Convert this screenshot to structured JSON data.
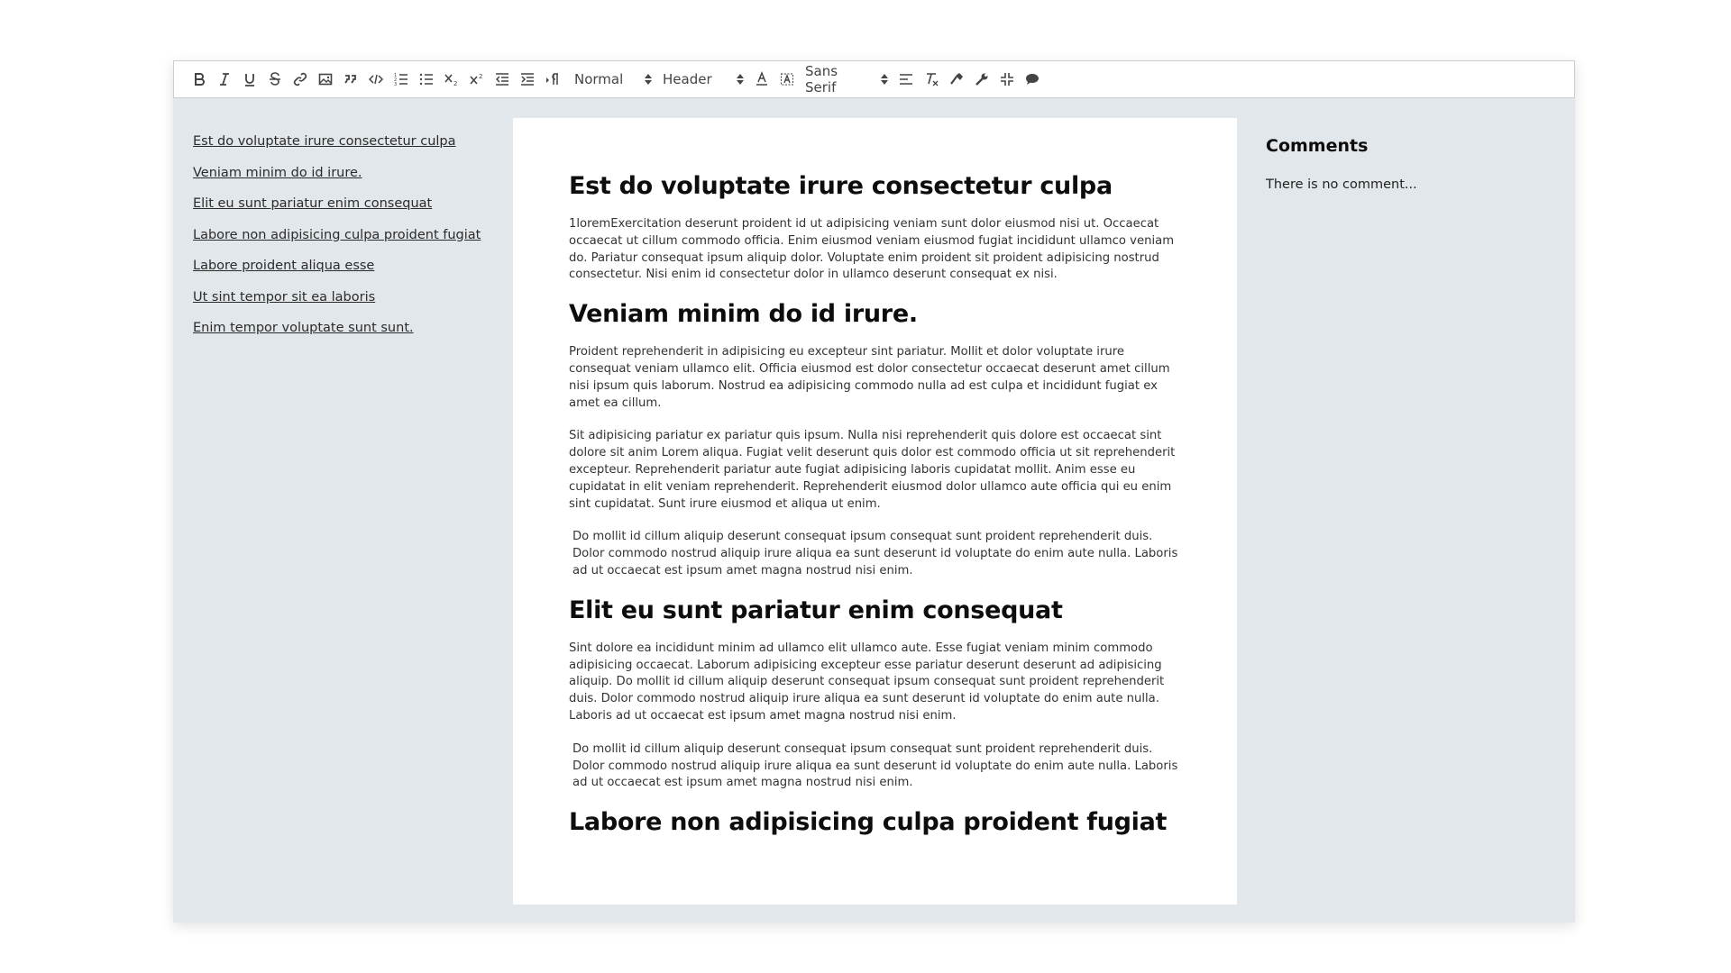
{
  "toolbar": {
    "format_select": "Normal",
    "header_select": "Header",
    "font_select": "Sans Serif"
  },
  "toc": [
    "Est do voluptate irure consectetur culpa",
    "Veniam minim do id irure.",
    "Elit eu sunt pariatur enim consequat",
    "Labore non adipisicing culpa proident fugiat",
    "Labore proident aliqua esse",
    "Ut sint tempor sit ea laboris",
    "Enim tempor voluptate sunt sunt."
  ],
  "document": {
    "h1": "Est do voluptate irure consectetur culpa",
    "p1": "1loremExercitation deserunt proident id ut adipisicing veniam sunt dolor eiusmod nisi ut. Occaecat occaecat ut cillum commodo officia. Enim eiusmod veniam eiusmod fugiat incididunt ullamco veniam do. Pariatur consequat ipsum aliquip dolor. Voluptate enim proident sit proident adipisicing nostrud consectetur. Nisi enim id consectetur dolor in ullamco deserunt consequat ex nisi.",
    "h2": "Veniam minim do id irure.",
    "p2": "Proident reprehenderit in adipisicing eu excepteur sint pariatur. Mollit et dolor voluptate irure consequat veniam ullamco elit. Officia eiusmod est dolor consectetur occaecat deserunt amet cillum nisi ipsum quis laborum. Nostrud ea adipisicing commodo nulla ad est culpa et incididunt fugiat ex amet ea cillum.",
    "p3": "Sit adipisicing pariatur ex pariatur quis ipsum. Nulla nisi reprehenderit quis dolore est occaecat sint dolore sit anim Lorem aliqua. Fugiat velit deserunt quis dolor est commodo officia ut sit reprehenderit excepteur. Reprehenderit pariatur aute fugiat adipisicing laboris cupidatat mollit. Anim esse eu cupidatat in elit veniam reprehenderit. Reprehenderit eiusmod dolor ullamco aute officia qui eu enim sint cupidatat. Sunt irure eiusmod et aliqua ut enim.",
    "p4": "Do mollit id cillum aliquip deserunt consequat ipsum consequat sunt proident reprehenderit duis. Dolor commodo nostrud aliquip irure aliqua ea sunt deserunt id voluptate do enim aute nulla. Laboris ad ut occaecat est ipsum amet magna nostrud nisi enim.",
    "h3": "Elit eu sunt pariatur enim consequat",
    "p5": "Sint dolore ea incididunt minim ad ullamco elit ullamco aute. Esse fugiat veniam minim commodo adipisicing occaecat. Laborum adipisicing excepteur esse pariatur deserunt deserunt ad adipisicing aliquip. Do mollit id cillum aliquip deserunt consequat ipsum consequat sunt proident reprehenderit duis. Dolor commodo nostrud aliquip irure aliqua ea sunt deserunt id voluptate do enim aute nulla. Laboris ad ut occaecat est ipsum amet magna nostrud nisi enim.",
    "p6": "Do mollit id cillum aliquip deserunt consequat ipsum consequat sunt proident reprehenderit duis. Dolor commodo nostrud aliquip irure aliqua ea sunt deserunt id voluptate do enim aute nulla. Laboris ad ut occaecat est ipsum amet magna nostrud nisi enim.",
    "h4": "Labore non adipisicing culpa proident fugiat"
  },
  "comments": {
    "title": "Comments",
    "empty": "There is no comment..."
  },
  "colors": {
    "workspace_bg": "#e2e7eb",
    "page_bg": "#ffffff",
    "toolbar_border": "#cccccc",
    "icon": "#444444"
  }
}
